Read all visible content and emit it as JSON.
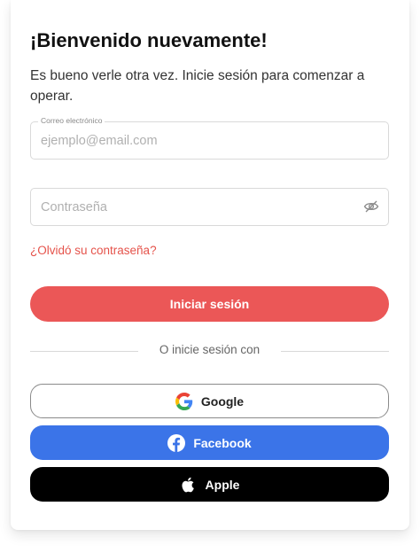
{
  "header": {
    "title": "¡Bienvenido nuevamente!",
    "subtitle": "Es bueno verle otra vez. Inicie sesión para comenzar a operar."
  },
  "form": {
    "email": {
      "label": "Correo electrónico",
      "placeholder": "ejemplo@email.com",
      "value": ""
    },
    "password": {
      "placeholder": "Contraseña",
      "value": "",
      "toggle_icon": "eye-off-icon"
    },
    "forgot_label": "¿Olvidó su contraseña?",
    "submit_label": "Iniciar sesión"
  },
  "divider": {
    "label": "O inicie sesión con"
  },
  "social": {
    "google": {
      "label": "Google",
      "icon": "google-icon"
    },
    "facebook": {
      "label": "Facebook",
      "icon": "facebook-icon"
    },
    "apple": {
      "label": "Apple",
      "icon": "apple-icon"
    }
  },
  "colors": {
    "accent": "#eb5757",
    "facebook": "#3b74e8",
    "apple": "#000000",
    "link": "#e5534b"
  }
}
